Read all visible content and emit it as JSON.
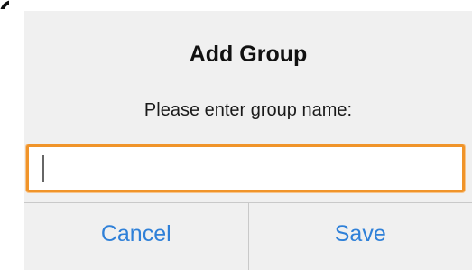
{
  "dialog": {
    "title": "Add Group",
    "message": "Please enter group name:",
    "input_value": "",
    "cancel_label": "Cancel",
    "save_label": "Save"
  },
  "colors": {
    "dialog_background": "#f0f0f0",
    "input_focus_border": "#f0942a",
    "button_text": "#2f80d8",
    "divider": "#c9c9c9"
  }
}
